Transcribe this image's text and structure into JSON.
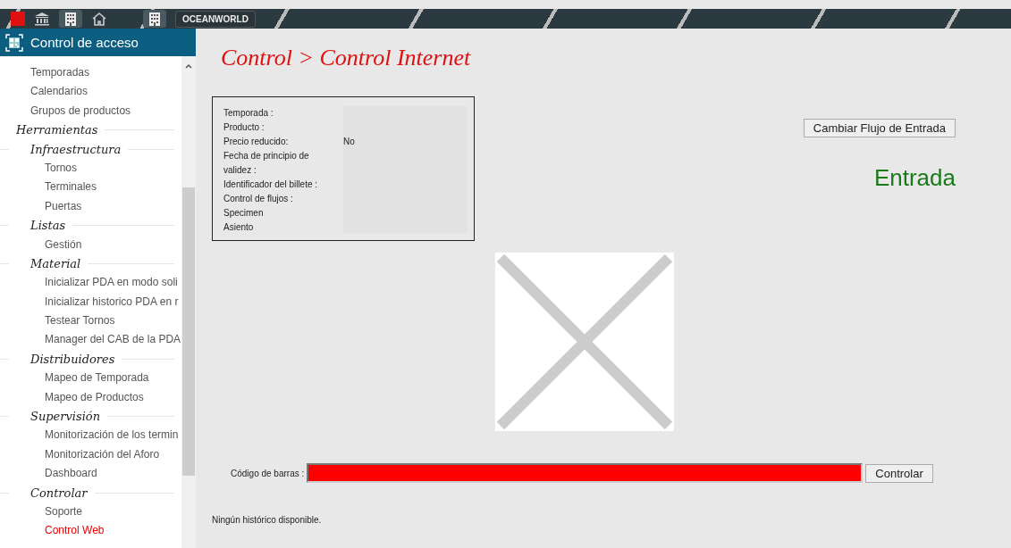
{
  "topbar": {
    "workspace": "OCEANWORLD"
  },
  "sidebar": {
    "title": "Control de acceso",
    "items": [
      {
        "label": "Temporadas",
        "selected": false
      },
      {
        "label": "Calendarios",
        "selected": false
      },
      {
        "label": "Grupos de productos",
        "selected": false
      }
    ],
    "section": {
      "label": "Herramientas",
      "children": [
        {
          "label": "Infraestructura",
          "children": [
            {
              "label": "Tornos",
              "selected": false
            },
            {
              "label": "Terminales",
              "selected": false
            },
            {
              "label": "Puertas",
              "selected": false
            }
          ]
        },
        {
          "label": "Listas",
          "children": [
            {
              "label": "Gestión",
              "selected": false
            }
          ]
        },
        {
          "label": "Material",
          "children": [
            {
              "label": "Inicializar PDA en modo soli",
              "selected": false
            },
            {
              "label": "Inicializar historico PDA en r",
              "selected": false
            },
            {
              "label": "Testear Tornos",
              "selected": false
            },
            {
              "label": "Manager del CAB de la PDA",
              "selected": false
            }
          ]
        },
        {
          "label": "Distribuidores",
          "children": [
            {
              "label": "Mapeo de Temporada",
              "selected": false
            },
            {
              "label": "Mapeo de Productos",
              "selected": false
            }
          ]
        },
        {
          "label": "Supervisión",
          "children": [
            {
              "label": "Monitorización de los termin",
              "selected": false
            },
            {
              "label": "Monitorización del Aforo",
              "selected": false
            },
            {
              "label": "Dashboard",
              "selected": false
            }
          ]
        },
        {
          "label": "Controlar",
          "children": [
            {
              "label": "Soporte",
              "selected": false
            },
            {
              "label": "Control Web",
              "selected": true
            }
          ]
        }
      ]
    }
  },
  "main": {
    "breadcrumb": [
      "Control",
      ">",
      "Control Internet"
    ],
    "details": [
      {
        "label": "Temporada :"
      },
      {
        "label": "Producto :"
      },
      {
        "label": "Precio reducido:",
        "value": "No"
      },
      {
        "label": "Fecha de principio de validez :"
      },
      {
        "label": "Identificador del billete :"
      },
      {
        "label": "Control de flujos :"
      },
      {
        "label": "Specimen"
      },
      {
        "label": "Asiento"
      }
    ],
    "flow_button": "Cambiar Flujo de Entrada",
    "flow_status": "Entrada",
    "barcode": {
      "label": "Código de barras :",
      "invalid": true
    },
    "control_button": "Controlar",
    "history": "Ningún histórico disponible."
  }
}
